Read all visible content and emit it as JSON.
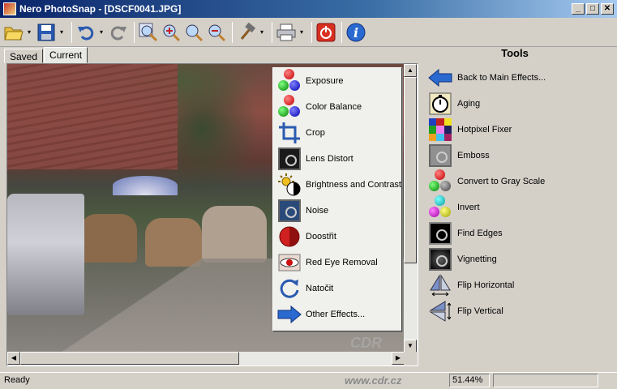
{
  "window": {
    "title": "Nero PhotoSnap - [DSCF0041.JPG]",
    "buttons": [
      "_",
      "□",
      "✕"
    ]
  },
  "toolbar": {
    "items": [
      "open-icon",
      "save-icon",
      "undo-icon",
      "redo-icon",
      "zoom-fit-icon",
      "zoom-in-icon",
      "zoom-actual-icon",
      "zoom-out-icon",
      "tools-hammer-icon",
      "print-icon",
      "exit-icon",
      "info-icon"
    ]
  },
  "tabs": [
    {
      "label": "Saved"
    },
    {
      "label": "Current"
    }
  ],
  "menu": {
    "items": [
      {
        "label": "Exposure"
      },
      {
        "label": "Color Balance"
      },
      {
        "label": "Crop"
      },
      {
        "label": "Lens Distort"
      },
      {
        "label": "Brightness and Contrast"
      },
      {
        "label": "Noise"
      },
      {
        "label": "Doostřit"
      },
      {
        "label": "Red Eye Removal"
      },
      {
        "label": "Natočit"
      },
      {
        "label": "Other Effects..."
      }
    ]
  },
  "tools": {
    "title": "Tools",
    "items": [
      {
        "label": "Back to Main Effects..."
      },
      {
        "label": "Aging"
      },
      {
        "label": "Hotpixel Fixer"
      },
      {
        "label": "Emboss"
      },
      {
        "label": "Convert to Gray Scale"
      },
      {
        "label": "Invert"
      },
      {
        "label": "Find Edges"
      },
      {
        "label": "Vignetting"
      },
      {
        "label": "Flip Horizontal"
      },
      {
        "label": "Flip Vertical"
      }
    ]
  },
  "status": {
    "text": "Ready",
    "zoom": "51.44%"
  },
  "watermark": {
    "logo": "CDR",
    "url": "www.cdr.cz"
  }
}
